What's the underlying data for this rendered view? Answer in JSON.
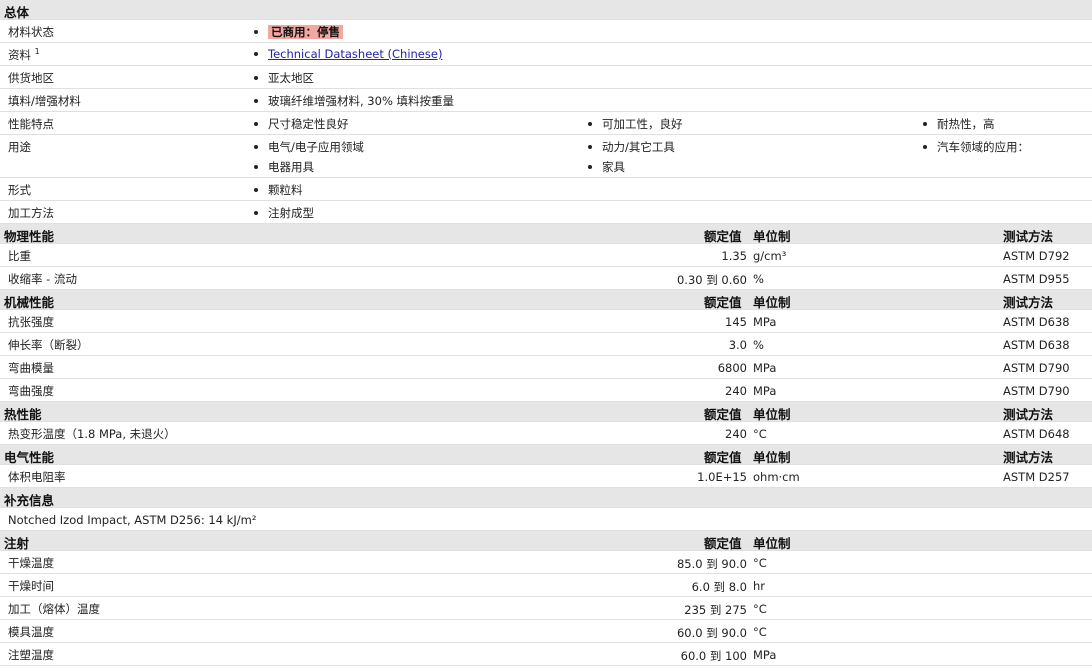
{
  "overview": {
    "section_title": "总体",
    "rows": [
      {
        "label": "材料状态",
        "items": [
          "已商用：停售"
        ]
      },
      {
        "label": "资料",
        "sup": "1",
        "items": [
          "Technical Datasheet (Chinese)"
        ]
      },
      {
        "label": "供货地区",
        "items": [
          "亚太地区"
        ]
      },
      {
        "label": "填料/增强材料",
        "items": [
          "玻璃纤维增强材料, 30% 填料按重量"
        ]
      },
      {
        "label": "性能特点",
        "items": [
          "尺寸稳定性良好",
          "可加工性，良好",
          "耐热性，高"
        ]
      },
      {
        "label": "用途",
        "items": [
          "电气/电子应用领域",
          "动力/其它工具",
          "汽车领域的应用：",
          "电器用具",
          "家具"
        ]
      },
      {
        "label": "形式",
        "items": [
          "颗粒料"
        ]
      },
      {
        "label": "加工方法",
        "items": [
          "注射成型"
        ]
      }
    ]
  },
  "headers": {
    "nominal": "额定值",
    "unit": "单位制",
    "method": "测试方法"
  },
  "physical": {
    "section_title": "物理性能",
    "rows": [
      {
        "label": "比重",
        "value": "1.35",
        "unit": "g/cm³",
        "method": "ASTM D792"
      },
      {
        "label": "收缩率  - 流动",
        "value": "0.30 到  0.60",
        "unit": "%",
        "method": "ASTM D955"
      }
    ]
  },
  "mechanical": {
    "section_title": "机械性能",
    "rows": [
      {
        "label": "抗张强度",
        "value": "145",
        "unit": "MPa",
        "method": "ASTM D638"
      },
      {
        "label": "伸长率（断裂）",
        "value": "3.0",
        "unit": "%",
        "method": "ASTM D638"
      },
      {
        "label": "弯曲模量",
        "value": "6800",
        "unit": "MPa",
        "method": "ASTM D790"
      },
      {
        "label": "弯曲强度",
        "value": "240",
        "unit": "MPa",
        "method": "ASTM D790"
      }
    ]
  },
  "thermal": {
    "section_title": "热性能",
    "rows": [
      {
        "label": "热变形温度（1.8 MPa, 未退火）",
        "value": "240",
        "unit": "°C",
        "method": "ASTM D648"
      }
    ]
  },
  "electrical": {
    "section_title": "电气性能",
    "rows": [
      {
        "label": "体积电阻率",
        "value": "1.0E+15",
        "unit": "ohm·cm",
        "method": "ASTM D257"
      }
    ]
  },
  "supplementary": {
    "section_title": "补充信息",
    "text": "Notched Izod Impact, ASTM D256: 14 kJ/m²"
  },
  "injection": {
    "section_title": "注射",
    "rows": [
      {
        "label": "干燥温度",
        "value": "85.0 到  90.0",
        "unit": "°C"
      },
      {
        "label": "干燥时间",
        "value": "6.0 到  8.0",
        "unit": "hr"
      },
      {
        "label": "加工（熔体）温度",
        "value": "235 到  275",
        "unit": "°C"
      },
      {
        "label": "模具温度",
        "value": "60.0 到  90.0",
        "unit": "°C"
      },
      {
        "label": "注塑温度",
        "value": "60.0 到  100",
        "unit": "MPa"
      }
    ]
  }
}
